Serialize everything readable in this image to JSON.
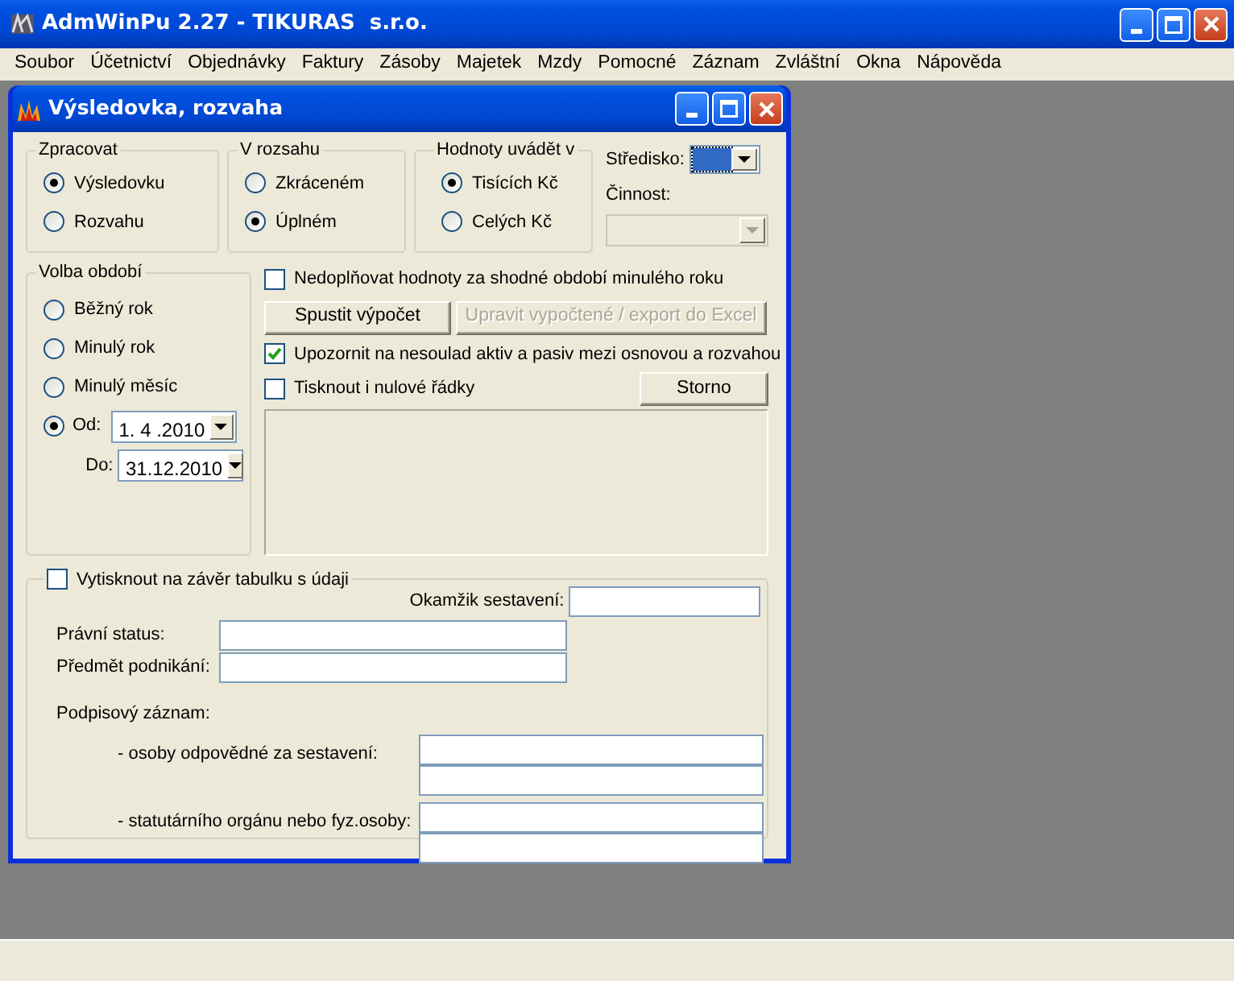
{
  "app_window": {
    "title": "AdmWinPu 2.27 - TIKURAS  s.r.o."
  },
  "menu": [
    "Soubor",
    "Účetnictví",
    "Objednávky",
    "Faktury",
    "Zásoby",
    "Majetek",
    "Mzdy",
    "Pomocné",
    "Záznam",
    "Zvláštní",
    "Okna",
    "Nápověda"
  ],
  "dialog": {
    "title": "Výsledovka, rozvaha",
    "groups": [
      {
        "label": "Zpracovat",
        "options": [
          {
            "label": "Výsledovku",
            "selected": true
          },
          {
            "label": "Rozvahu",
            "selected": false
          }
        ]
      },
      {
        "label": "V rozsahu",
        "options": [
          {
            "label": "Zkráceném",
            "selected": false
          },
          {
            "label": "Úplném",
            "selected": true
          }
        ]
      },
      {
        "label": "Hodnoty uvádět v",
        "options": [
          {
            "label": "Tisících Kč",
            "selected": true
          },
          {
            "label": "Celých Kč",
            "selected": false
          }
        ]
      }
    ],
    "center": {
      "label": "Středisko:",
      "focused": true
    },
    "activity": {
      "label": "Činnost:",
      "disabled": true
    },
    "period": {
      "label": "Volba období",
      "options": [
        {
          "label": "Běžný rok",
          "selected": false
        },
        {
          "label": "Minulý rok",
          "selected": false
        },
        {
          "label": "Minulý měsíc",
          "selected": false
        },
        {
          "label": "Od:",
          "selected": true
        }
      ],
      "from": "1. 4 .2010",
      "to_label": "Do:",
      "to": "31.12.2010"
    },
    "no_fill": {
      "label": "Nedoplňovat hodnoty za shodné období minulého roku",
      "checked": false
    },
    "buttons": [
      {
        "label": "Spustit výpočet",
        "disabled": false
      },
      {
        "label": "Upravit vypočtené / export do Excel",
        "disabled": true
      }
    ],
    "warn": {
      "label": "Upozornit na nesoulad aktiv a pasiv mezi osnovou a rozvahou",
      "checked": true
    },
    "zero_rows": {
      "label": "Tisknout i nulové řádky",
      "checked": false
    },
    "cancel": {
      "label": "Storno"
    },
    "summary": {
      "label": "Vytisknout na závěr tabulku s údaji",
      "checked": false,
      "moment_label": "Okamžik sestavení:",
      "legal_status_label": "Právní status:",
      "subject_label": "Předmět podnikání:",
      "signature_label": "Podpisový záznam:",
      "responsible_label": "- osoby odpovědné za sestavení:",
      "statutory_label": "- statutárního orgánu nebo fyz.osoby:"
    }
  }
}
